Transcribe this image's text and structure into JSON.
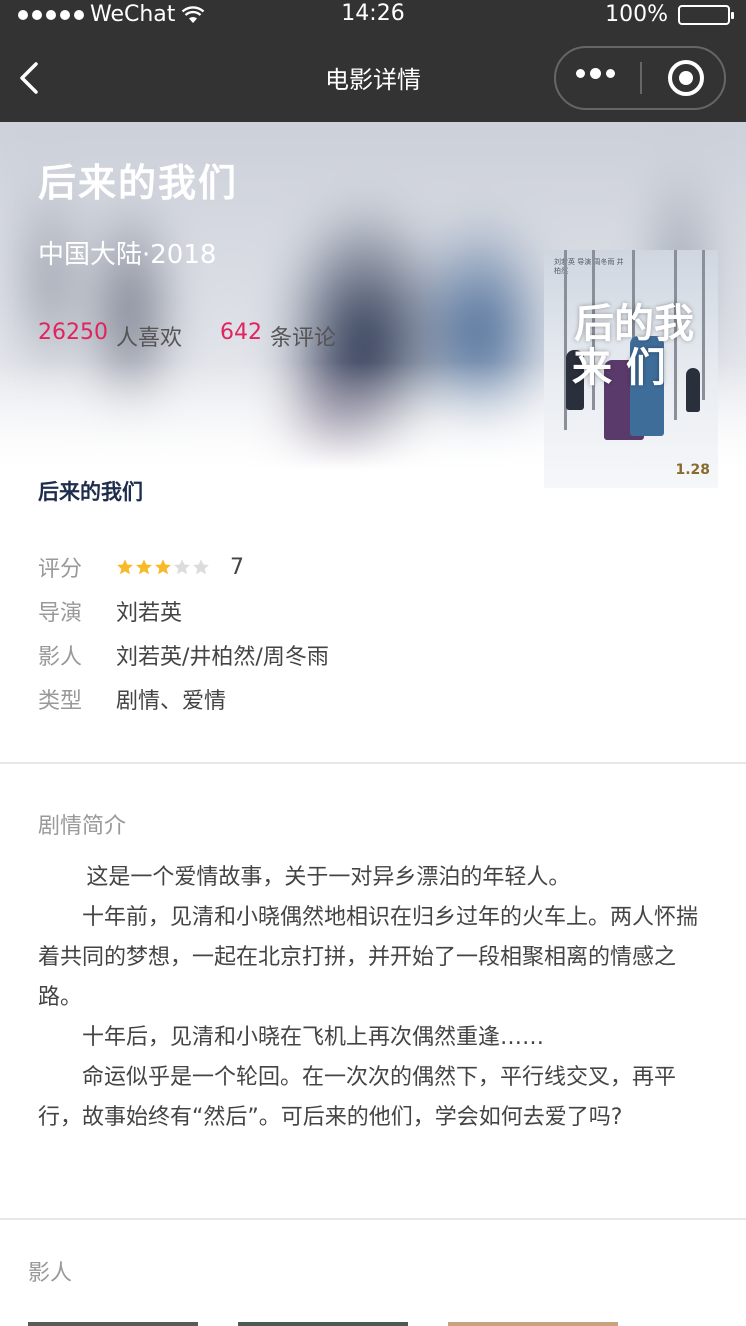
{
  "status_bar": {
    "carrier": "WeChat",
    "time": "14:26",
    "battery": "100%"
  },
  "nav": {
    "title": "电影详情"
  },
  "movie": {
    "title": "后来的我们",
    "region_year": "中国大陆·2018",
    "likes_count": "26250",
    "likes_suffix": "人喜欢",
    "comments_count": "642",
    "comments_suffix": "条评论",
    "subtitle": "后来的我们",
    "poster": {
      "title_line1": "后的我",
      "title_line2": "来 们",
      "date": "1.28",
      "credits": "刘若英 导演 周冬雨 井柏然"
    }
  },
  "info": {
    "rating": {
      "label": "评分",
      "value": "7",
      "stars_filled": 3,
      "stars_total": 5
    },
    "director": {
      "label": "导演",
      "value": "刘若英"
    },
    "cast": {
      "label": "影人",
      "value": "刘若英/井柏然/周冬雨"
    },
    "genre": {
      "label": "类型",
      "value": "剧情、爱情"
    }
  },
  "synopsis": {
    "label": "剧情简介",
    "paragraphs": [
      "这是一个爱情故事，关于一对异乡漂泊的年轻人。",
      "十年前，见清和小晓偶然地相识在归乡过年的火车上。两人怀揣着共同的梦想，一起在北京打拼，并开始了一段相聚相离的情感之路。",
      "十年后，见清和小晓在飞机上再次偶然重逢……",
      "命运似乎是一个轮回。在一次次的偶然下，平行线交叉，再平行，故事始终有“然后”。可后来的他们，学会如何去爱了吗?"
    ]
  },
  "cast_section": {
    "label": "影人"
  },
  "colors": {
    "accent": "#e0245e",
    "star_on": "#f7ba2a",
    "star_off": "#dcdcdc",
    "bar": "#333333"
  }
}
